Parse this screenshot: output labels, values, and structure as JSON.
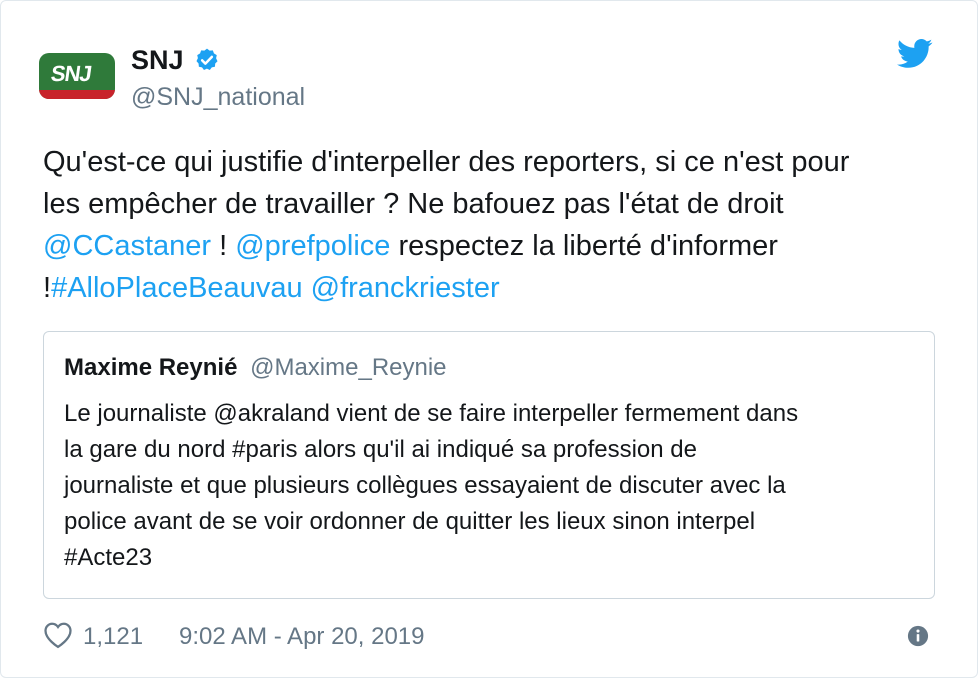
{
  "author": {
    "display_name": "SNJ",
    "handle": "@SNJ_national",
    "avatar_text": "SNJ",
    "verified_icon": "verified-badge-icon"
  },
  "tweet": {
    "line1": "Qu'est-ce qui justifie d'interpeller des reporters, si ce n'est pour",
    "line2": "les empêcher de travailler ? Ne bafouez pas l'état de droit",
    "mention1": "@CCastaner",
    "sep1": " ! ",
    "mention2": "@prefpolice",
    "line3_rest": " respectez la liberté d'informer",
    "line4_prefix": "!",
    "hashtag": "#AlloPlaceBeauvau",
    "mention3": "@franckriester"
  },
  "quoted": {
    "name": "Maxime Reynié",
    "handle": "@Maxime_Reynie",
    "line1": "Le journaliste @akraland vient de se faire interpeller fermement dans",
    "line2": "la gare du nord #paris alors qu'il ai indiqué sa profession de",
    "line3": "journaliste et que plusieurs collègues essayaient de discuter avec la",
    "line4": "police avant de se voir ordonner de quitter les lieux sinon interpel",
    "line5": "#Acte23"
  },
  "footer": {
    "likes": "1,121",
    "timestamp": "9:02 AM - Apr 20, 2019"
  },
  "colors": {
    "link": "#1da1f2",
    "secondary_text": "#657786",
    "avatar_green": "#2f7a3a",
    "avatar_red": "#c8232b"
  }
}
